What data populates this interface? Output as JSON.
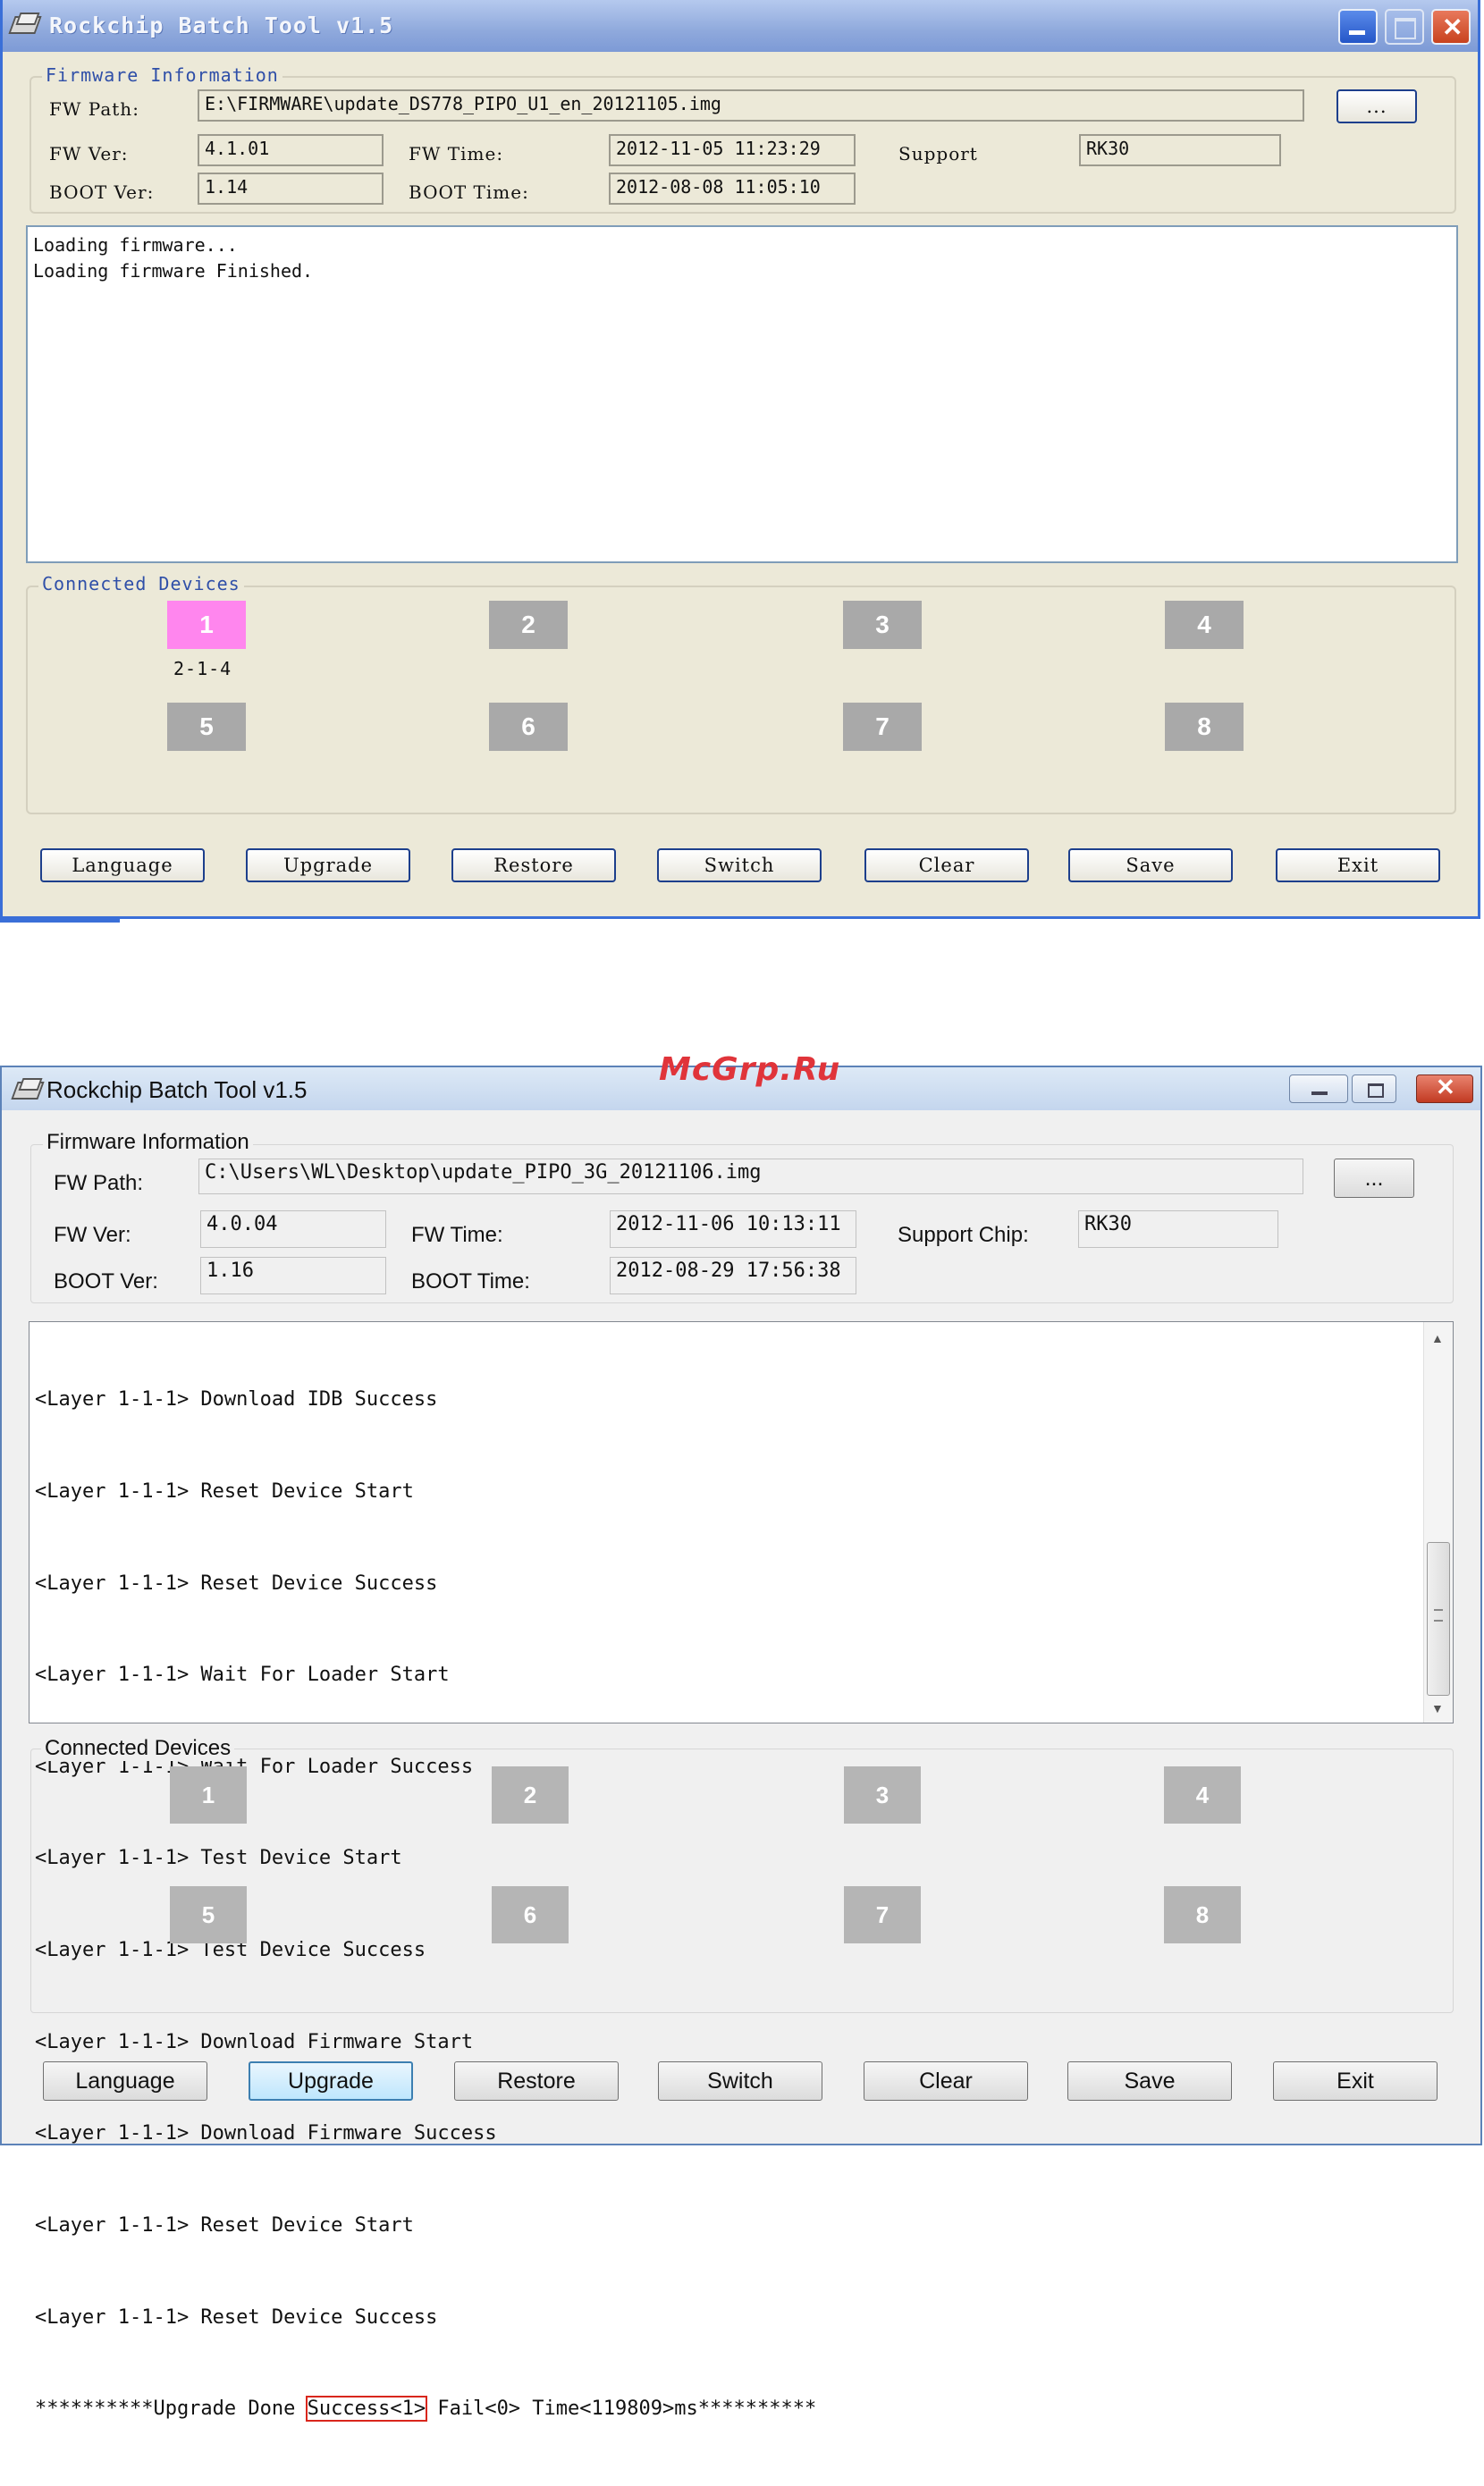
{
  "window1": {
    "title": "Rockchip Batch Tool v1.5",
    "firmware_group": "Firmware Information",
    "fw_path_label": "FW Path:",
    "fw_path": "E:\\FIRMWARE\\update_DS778_PIPO_U1_en_20121105.img",
    "browse_label": "...",
    "fw_ver_label": "FW Ver:",
    "fw_ver": "4.1.01",
    "fw_time_label": "FW Time:",
    "fw_time": "2012-11-05 11:23:29",
    "support_label": "Support",
    "support_chip": "RK30",
    "boot_ver_label": "BOOT Ver:",
    "boot_ver": "1.14",
    "boot_time_label": "BOOT Time:",
    "boot_time": "2012-08-08 11:05:10",
    "log": [
      "Loading firmware...",
      "Loading firmware Finished."
    ],
    "devices_group": "Connected Devices",
    "devices": [
      "1",
      "2",
      "3",
      "4",
      "5",
      "6",
      "7",
      "8"
    ],
    "device1_location": "2-1-4",
    "active_device_color": "#ff86ee",
    "buttons": [
      "Language",
      "Upgrade",
      "Restore",
      "Switch",
      "Clear",
      "Save",
      "Exit"
    ]
  },
  "window2": {
    "title": "Rockchip Batch Tool v1.5",
    "firmware_group": "Firmware Information",
    "fw_path_label": "FW Path:",
    "fw_path": "C:\\Users\\WL\\Desktop\\update_PIPO_3G_20121106.img",
    "browse_label": "...",
    "fw_ver_label": "FW Ver:",
    "fw_ver": "4.0.04",
    "fw_time_label": "FW Time:",
    "fw_time": "2012-11-06 10:13:11",
    "support_label": "Support Chip:",
    "support_chip": "RK30",
    "boot_ver_label": "BOOT Ver:",
    "boot_ver": "1.16",
    "boot_time_label": "BOOT Time:",
    "boot_time": "2012-08-29 17:56:38",
    "log": [
      "<Layer 1-1-1> Download IDB Success",
      "<Layer 1-1-1> Reset Device Start",
      "<Layer 1-1-1> Reset Device Success",
      "<Layer 1-1-1> Wait For Loader Start",
      "<Layer 1-1-1> Wait For Loader Success",
      "<Layer 1-1-1> Test Device Start",
      "<Layer 1-1-1> Test Device Success",
      "<Layer 1-1-1> Download Firmware Start",
      "<Layer 1-1-1> Download Firmware Success",
      "<Layer 1-1-1> Reset Device Start",
      "<Layer 1-1-1> Reset Device Success"
    ],
    "summary_prefix": "**********Upgrade Done ",
    "summary_success": "Success<1>",
    "summary_suffix": " Fail<0> Time<119809>ms**********",
    "devices_group": "Connected Devices",
    "devices": [
      "1",
      "2",
      "3",
      "4",
      "5",
      "6",
      "7",
      "8"
    ],
    "buttons": [
      "Language",
      "Upgrade",
      "Restore",
      "Switch",
      "Clear",
      "Save",
      "Exit"
    ],
    "focused_button": "Upgrade"
  },
  "watermark": "McGrp.Ru",
  "colors": {
    "xp_title": "#8fa9dc",
    "win7_title": "#c4d6ee",
    "device_idle": "#a9a9a9",
    "highlight_box": "#d9261c"
  }
}
